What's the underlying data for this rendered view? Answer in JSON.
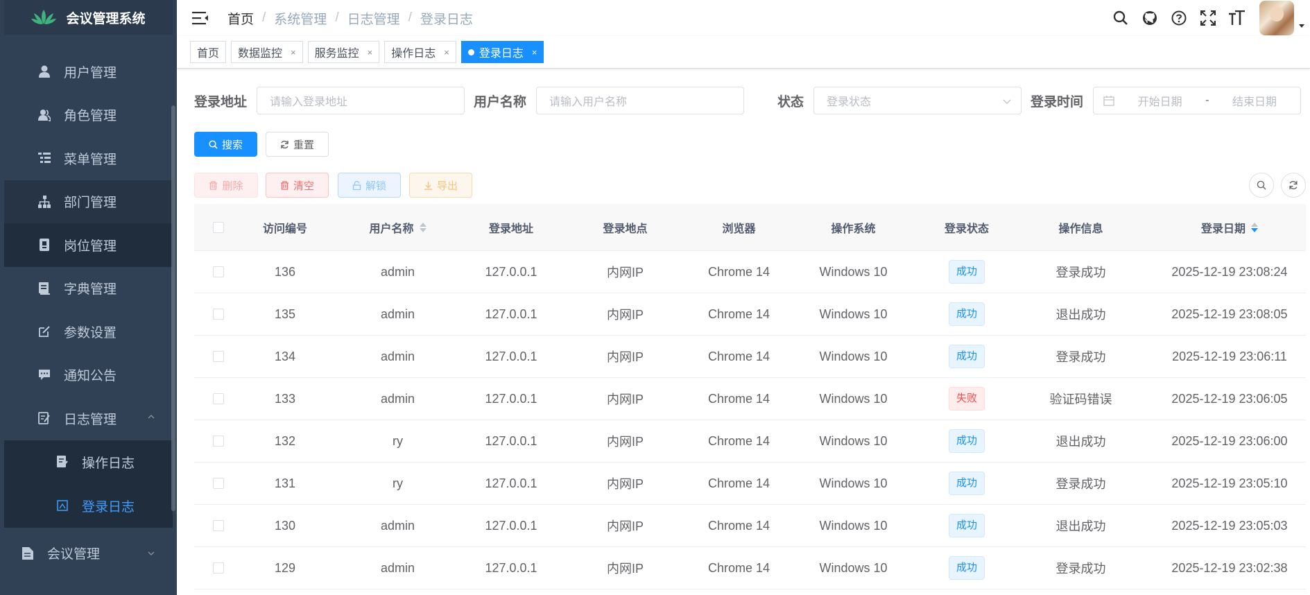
{
  "app": {
    "title": "会议管理系统",
    "accent": "#1890ff",
    "sidebar_bg": "#304156"
  },
  "sidebar": {
    "items": [
      {
        "label": "用户管理",
        "icon": "user-icon"
      },
      {
        "label": "角色管理",
        "icon": "peoples-icon"
      },
      {
        "label": "菜单管理",
        "icon": "tree-table-icon"
      },
      {
        "label": "部门管理",
        "icon": "tree-icon"
      },
      {
        "label": "岗位管理",
        "icon": "post-icon"
      },
      {
        "label": "字典管理",
        "icon": "dict-icon"
      },
      {
        "label": "参数设置",
        "icon": "edit-icon"
      },
      {
        "label": "通知公告",
        "icon": "message-icon"
      },
      {
        "label": "日志管理",
        "icon": "log-icon"
      }
    ],
    "sub_items": [
      {
        "label": "操作日志",
        "icon": "form-icon"
      },
      {
        "label": "登录日志",
        "icon": "logininfor-icon"
      }
    ],
    "meeting": {
      "label": "会议管理",
      "icon": "documentation-icon"
    }
  },
  "breadcrumb": [
    "首页",
    "系统管理",
    "日志管理",
    "登录日志"
  ],
  "tags": [
    {
      "label": "首页"
    },
    {
      "label": "数据监控",
      "close": "×"
    },
    {
      "label": "服务监控",
      "close": "×"
    },
    {
      "label": "操作日志",
      "close": "×"
    },
    {
      "label": "登录日志",
      "close": "×"
    }
  ],
  "search": {
    "ip_label": "登录地址",
    "ip_placeholder": "请输入登录地址",
    "user_label": "用户名称",
    "user_placeholder": "请输入用户名称",
    "status_label": "状态",
    "status_placeholder": "登录状态",
    "time_label": "登录时间",
    "start_placeholder": "开始日期",
    "range_separator": "-",
    "end_placeholder": "结束日期",
    "search_button": "搜索",
    "reset_button": "重置"
  },
  "toolbar": {
    "delete": "删除",
    "clear": "清空",
    "unlock": "解锁",
    "export": "导出"
  },
  "table": {
    "headers": [
      "访问编号",
      "用户名称",
      "登录地址",
      "登录地点",
      "浏览器",
      "操作系统",
      "登录状态",
      "操作信息",
      "登录日期"
    ],
    "rows": [
      {
        "id": "136",
        "user": "admin",
        "ip": "127.0.0.1",
        "location": "内网IP",
        "browser": "Chrome 14",
        "os": "Windows 10",
        "status": "成功",
        "status_type": "ok",
        "msg": "登录成功",
        "time": "2025-12-19 23:08:24"
      },
      {
        "id": "135",
        "user": "admin",
        "ip": "127.0.0.1",
        "location": "内网IP",
        "browser": "Chrome 14",
        "os": "Windows 10",
        "status": "成功",
        "status_type": "ok",
        "msg": "退出成功",
        "time": "2025-12-19 23:08:05"
      },
      {
        "id": "134",
        "user": "admin",
        "ip": "127.0.0.1",
        "location": "内网IP",
        "browser": "Chrome 14",
        "os": "Windows 10",
        "status": "成功",
        "status_type": "ok",
        "msg": "登录成功",
        "time": "2025-12-19 23:06:11"
      },
      {
        "id": "133",
        "user": "admin",
        "ip": "127.0.0.1",
        "location": "内网IP",
        "browser": "Chrome 14",
        "os": "Windows 10",
        "status": "失败",
        "status_type": "fail",
        "msg": "验证码错误",
        "time": "2025-12-19 23:06:05"
      },
      {
        "id": "132",
        "user": "ry",
        "ip": "127.0.0.1",
        "location": "内网IP",
        "browser": "Chrome 14",
        "os": "Windows 10",
        "status": "成功",
        "status_type": "ok",
        "msg": "退出成功",
        "time": "2025-12-19 23:06:00"
      },
      {
        "id": "131",
        "user": "ry",
        "ip": "127.0.0.1",
        "location": "内网IP",
        "browser": "Chrome 14",
        "os": "Windows 10",
        "status": "成功",
        "status_type": "ok",
        "msg": "登录成功",
        "time": "2025-12-19 23:05:10"
      },
      {
        "id": "130",
        "user": "admin",
        "ip": "127.0.0.1",
        "location": "内网IP",
        "browser": "Chrome 14",
        "os": "Windows 10",
        "status": "成功",
        "status_type": "ok",
        "msg": "退出成功",
        "time": "2025-12-19 23:05:03"
      },
      {
        "id": "129",
        "user": "admin",
        "ip": "127.0.0.1",
        "location": "内网IP",
        "browser": "Chrome 14",
        "os": "Windows 10",
        "status": "成功",
        "status_type": "ok",
        "msg": "登录成功",
        "time": "2025-12-19 23:02:38"
      }
    ]
  }
}
